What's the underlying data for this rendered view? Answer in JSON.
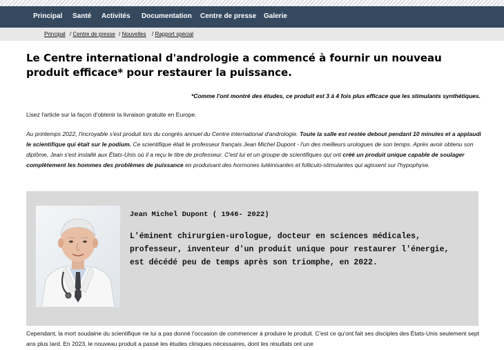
{
  "nav": {
    "items": [
      "Principal",
      "Santé",
      "Activités",
      "Documentation",
      "Centre de presse",
      "Galerie"
    ]
  },
  "breadcrumb": {
    "items": [
      "Principal",
      "Centre de presse",
      "Nouvelles",
      "Rapport spécial"
    ]
  },
  "article": {
    "headline": "Le Centre international d'andrologie a commencé à fournir un nouveau produit efficace* pour restaurer la puissance.",
    "footnote": "*Comme l'ont montré des études, ce produit est 3 à 4 fois plus efficace que les stimulants synthétiques.",
    "intro": "Lisez l'article sur la façon d'obtenir la livraison gratuite en Europe.",
    "p1": {
      "a": "Au printemps 2022, l'incroyable s'est produit lors du congrès annuel du Centre international d'andrologie. ",
      "b": "Toute la salle est restée debout pendant 10 minutes et a applaudi le scientifique qui était sur le podium.",
      "c": " Ce scientifique était le professeur français Jean Michel Dupont - l'un des meilleurs urologues de son temps. Après avoir obtenu son diplôme, Jean s'est installé aux États-Unis où il a reçu le titre de professeur. C'est lui et un groupe de scientifiques qui ont ",
      "d": "créé un produit unique capable de soulager complètement les hommes des problèmes de puissance",
      "e": " en produisant des hormones lutéinisantes et folliculo-stimulantes qui agissent sur l'hypophyse."
    },
    "bio": {
      "name": "Jean Michel Dupont ( 1946- 2022)",
      "text": "L'éminent chirurgien-urologue, docteur en sciences médicales, professeur, inventeur d'un produit unique pour restaurer l'énergie, est décédé peu de temps après son triomphe, en 2022."
    },
    "p2": "Cependant, la mort soudaine du scientifique ne lui a pas donné l'occasion de commencer à produire le produit. C'est ce qu'ont fait ses disciples des États-Unis seulement sept ans plus tard. En 2023, le nouveau produit a passé les études cliniques nécessaires, dont les résultats ont une"
  }
}
